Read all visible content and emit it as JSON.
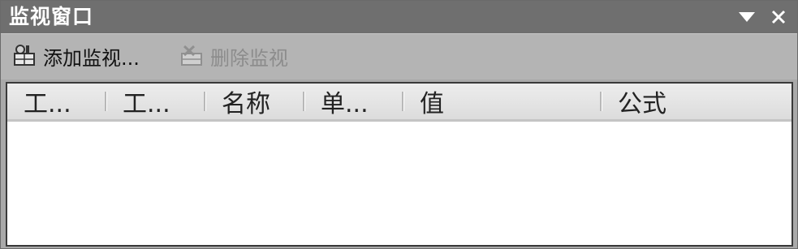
{
  "window": {
    "title": "监视窗口",
    "menu_icon": "dropdown-triangle-icon",
    "close_icon": "close-icon"
  },
  "toolbar": {
    "add_label": "添加监视...",
    "add_icon": "add-watch-icon",
    "delete_label": "删除监视",
    "delete_icon": "delete-watch-icon",
    "delete_enabled": false
  },
  "list": {
    "columns": [
      "工...",
      "工...",
      "名称",
      "单...",
      "值",
      "公式"
    ],
    "rows": []
  }
}
